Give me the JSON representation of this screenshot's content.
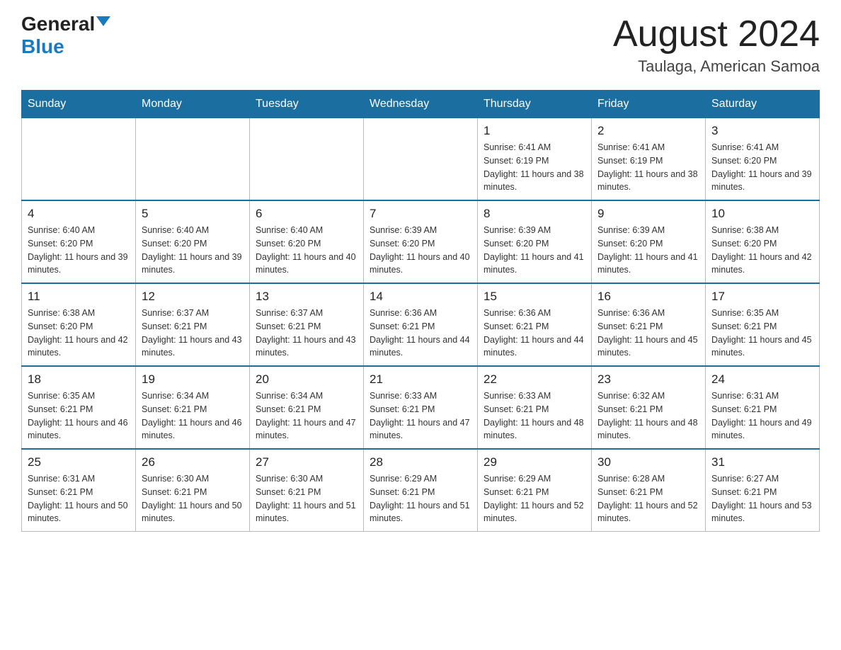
{
  "header": {
    "logo_general": "General",
    "logo_blue": "Blue",
    "title": "August 2024",
    "subtitle": "Taulaga, American Samoa"
  },
  "days_of_week": [
    "Sunday",
    "Monday",
    "Tuesday",
    "Wednesday",
    "Thursday",
    "Friday",
    "Saturday"
  ],
  "weeks": [
    [
      {
        "day": "",
        "sunrise": "",
        "sunset": "",
        "daylight": ""
      },
      {
        "day": "",
        "sunrise": "",
        "sunset": "",
        "daylight": ""
      },
      {
        "day": "",
        "sunrise": "",
        "sunset": "",
        "daylight": ""
      },
      {
        "day": "",
        "sunrise": "",
        "sunset": "",
        "daylight": ""
      },
      {
        "day": "1",
        "sunrise": "Sunrise: 6:41 AM",
        "sunset": "Sunset: 6:19 PM",
        "daylight": "Daylight: 11 hours and 38 minutes."
      },
      {
        "day": "2",
        "sunrise": "Sunrise: 6:41 AM",
        "sunset": "Sunset: 6:19 PM",
        "daylight": "Daylight: 11 hours and 38 minutes."
      },
      {
        "day": "3",
        "sunrise": "Sunrise: 6:41 AM",
        "sunset": "Sunset: 6:20 PM",
        "daylight": "Daylight: 11 hours and 39 minutes."
      }
    ],
    [
      {
        "day": "4",
        "sunrise": "Sunrise: 6:40 AM",
        "sunset": "Sunset: 6:20 PM",
        "daylight": "Daylight: 11 hours and 39 minutes."
      },
      {
        "day": "5",
        "sunrise": "Sunrise: 6:40 AM",
        "sunset": "Sunset: 6:20 PM",
        "daylight": "Daylight: 11 hours and 39 minutes."
      },
      {
        "day": "6",
        "sunrise": "Sunrise: 6:40 AM",
        "sunset": "Sunset: 6:20 PM",
        "daylight": "Daylight: 11 hours and 40 minutes."
      },
      {
        "day": "7",
        "sunrise": "Sunrise: 6:39 AM",
        "sunset": "Sunset: 6:20 PM",
        "daylight": "Daylight: 11 hours and 40 minutes."
      },
      {
        "day": "8",
        "sunrise": "Sunrise: 6:39 AM",
        "sunset": "Sunset: 6:20 PM",
        "daylight": "Daylight: 11 hours and 41 minutes."
      },
      {
        "day": "9",
        "sunrise": "Sunrise: 6:39 AM",
        "sunset": "Sunset: 6:20 PM",
        "daylight": "Daylight: 11 hours and 41 minutes."
      },
      {
        "day": "10",
        "sunrise": "Sunrise: 6:38 AM",
        "sunset": "Sunset: 6:20 PM",
        "daylight": "Daylight: 11 hours and 42 minutes."
      }
    ],
    [
      {
        "day": "11",
        "sunrise": "Sunrise: 6:38 AM",
        "sunset": "Sunset: 6:20 PM",
        "daylight": "Daylight: 11 hours and 42 minutes."
      },
      {
        "day": "12",
        "sunrise": "Sunrise: 6:37 AM",
        "sunset": "Sunset: 6:21 PM",
        "daylight": "Daylight: 11 hours and 43 minutes."
      },
      {
        "day": "13",
        "sunrise": "Sunrise: 6:37 AM",
        "sunset": "Sunset: 6:21 PM",
        "daylight": "Daylight: 11 hours and 43 minutes."
      },
      {
        "day": "14",
        "sunrise": "Sunrise: 6:36 AM",
        "sunset": "Sunset: 6:21 PM",
        "daylight": "Daylight: 11 hours and 44 minutes."
      },
      {
        "day": "15",
        "sunrise": "Sunrise: 6:36 AM",
        "sunset": "Sunset: 6:21 PM",
        "daylight": "Daylight: 11 hours and 44 minutes."
      },
      {
        "day": "16",
        "sunrise": "Sunrise: 6:36 AM",
        "sunset": "Sunset: 6:21 PM",
        "daylight": "Daylight: 11 hours and 45 minutes."
      },
      {
        "day": "17",
        "sunrise": "Sunrise: 6:35 AM",
        "sunset": "Sunset: 6:21 PM",
        "daylight": "Daylight: 11 hours and 45 minutes."
      }
    ],
    [
      {
        "day": "18",
        "sunrise": "Sunrise: 6:35 AM",
        "sunset": "Sunset: 6:21 PM",
        "daylight": "Daylight: 11 hours and 46 minutes."
      },
      {
        "day": "19",
        "sunrise": "Sunrise: 6:34 AM",
        "sunset": "Sunset: 6:21 PM",
        "daylight": "Daylight: 11 hours and 46 minutes."
      },
      {
        "day": "20",
        "sunrise": "Sunrise: 6:34 AM",
        "sunset": "Sunset: 6:21 PM",
        "daylight": "Daylight: 11 hours and 47 minutes."
      },
      {
        "day": "21",
        "sunrise": "Sunrise: 6:33 AM",
        "sunset": "Sunset: 6:21 PM",
        "daylight": "Daylight: 11 hours and 47 minutes."
      },
      {
        "day": "22",
        "sunrise": "Sunrise: 6:33 AM",
        "sunset": "Sunset: 6:21 PM",
        "daylight": "Daylight: 11 hours and 48 minutes."
      },
      {
        "day": "23",
        "sunrise": "Sunrise: 6:32 AM",
        "sunset": "Sunset: 6:21 PM",
        "daylight": "Daylight: 11 hours and 48 minutes."
      },
      {
        "day": "24",
        "sunrise": "Sunrise: 6:31 AM",
        "sunset": "Sunset: 6:21 PM",
        "daylight": "Daylight: 11 hours and 49 minutes."
      }
    ],
    [
      {
        "day": "25",
        "sunrise": "Sunrise: 6:31 AM",
        "sunset": "Sunset: 6:21 PM",
        "daylight": "Daylight: 11 hours and 50 minutes."
      },
      {
        "day": "26",
        "sunrise": "Sunrise: 6:30 AM",
        "sunset": "Sunset: 6:21 PM",
        "daylight": "Daylight: 11 hours and 50 minutes."
      },
      {
        "day": "27",
        "sunrise": "Sunrise: 6:30 AM",
        "sunset": "Sunset: 6:21 PM",
        "daylight": "Daylight: 11 hours and 51 minutes."
      },
      {
        "day": "28",
        "sunrise": "Sunrise: 6:29 AM",
        "sunset": "Sunset: 6:21 PM",
        "daylight": "Daylight: 11 hours and 51 minutes."
      },
      {
        "day": "29",
        "sunrise": "Sunrise: 6:29 AM",
        "sunset": "Sunset: 6:21 PM",
        "daylight": "Daylight: 11 hours and 52 minutes."
      },
      {
        "day": "30",
        "sunrise": "Sunrise: 6:28 AM",
        "sunset": "Sunset: 6:21 PM",
        "daylight": "Daylight: 11 hours and 52 minutes."
      },
      {
        "day": "31",
        "sunrise": "Sunrise: 6:27 AM",
        "sunset": "Sunset: 6:21 PM",
        "daylight": "Daylight: 11 hours and 53 minutes."
      }
    ]
  ]
}
